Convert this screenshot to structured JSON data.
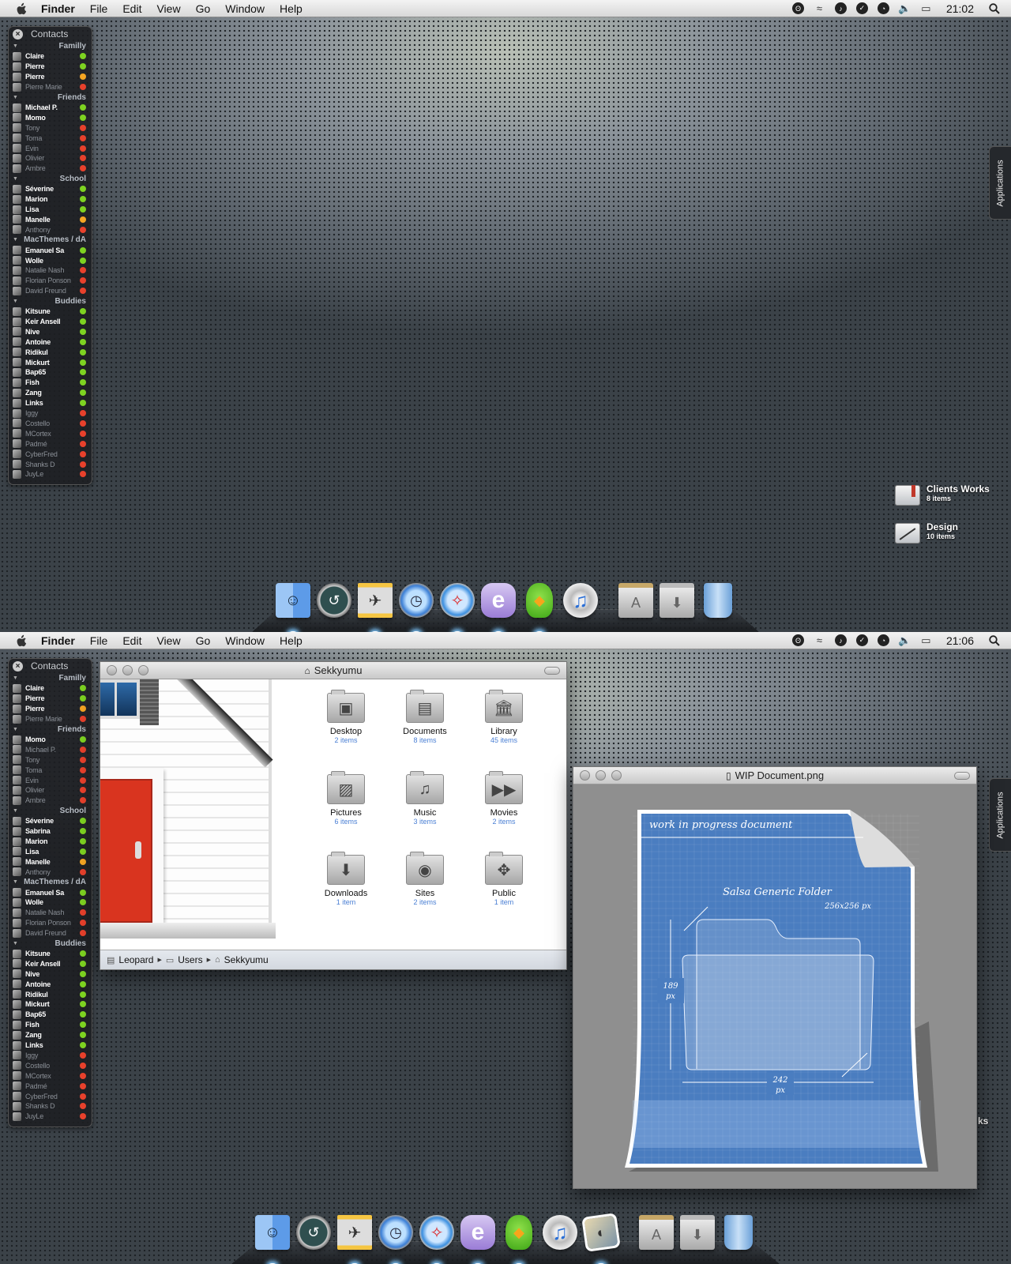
{
  "menubar": {
    "app": "Finder",
    "menus": [
      "File",
      "Edit",
      "View",
      "Go",
      "Window",
      "Help"
    ],
    "status_icons": [
      "growl-icon",
      "sync-icon",
      "itunes-icon",
      "checkmark-icon",
      "timer-icon",
      "volume-icon",
      "battery-icon"
    ]
  },
  "colors": {
    "online": "#7ed321",
    "away": "#f5a623",
    "offline": "#e8412c",
    "item_count": "#4a7fd4",
    "door": "#d9341f"
  },
  "screens": [
    {
      "clock": "21:02",
      "stack_tab": "Applications",
      "contacts": {
        "title": "Contacts",
        "groups": [
          {
            "name": "Familly",
            "members": [
              {
                "name": "Claire",
                "status": "online"
              },
              {
                "name": "Pierre",
                "status": "online"
              },
              {
                "name": "Pierre",
                "status": "away"
              },
              {
                "name": "Pierre Marie",
                "status": "offline"
              }
            ]
          },
          {
            "name": "Friends",
            "members": [
              {
                "name": "Michael P.",
                "status": "online"
              },
              {
                "name": "Momo",
                "status": "online"
              },
              {
                "name": "Tony",
                "status": "offline"
              },
              {
                "name": "Toma",
                "status": "offline"
              },
              {
                "name": "Evin",
                "status": "offline"
              },
              {
                "name": "Olivier",
                "status": "offline"
              },
              {
                "name": "Ambre",
                "status": "offline"
              }
            ]
          },
          {
            "name": "School",
            "members": [
              {
                "name": "Séverine",
                "status": "online"
              },
              {
                "name": "Marion",
                "status": "online"
              },
              {
                "name": "Lisa",
                "status": "online"
              },
              {
                "name": "Manelle",
                "status": "away"
              },
              {
                "name": "Anthony",
                "status": "offline"
              }
            ]
          },
          {
            "name": "MacThemes / dA",
            "members": [
              {
                "name": "Emanuel Sa",
                "status": "online"
              },
              {
                "name": "Wolle",
                "status": "online"
              },
              {
                "name": "Natalie Nash",
                "status": "offline"
              },
              {
                "name": "Florian Ponson",
                "status": "offline"
              },
              {
                "name": "David Freund",
                "status": "offline"
              }
            ]
          },
          {
            "name": "Buddies",
            "members": [
              {
                "name": "Kitsune",
                "status": "online"
              },
              {
                "name": "Keir Ansell",
                "status": "online"
              },
              {
                "name": "Nive",
                "status": "online"
              },
              {
                "name": "Antoine",
                "status": "online"
              },
              {
                "name": "Ridikul",
                "status": "online"
              },
              {
                "name": "Mickurt",
                "status": "online"
              },
              {
                "name": "Bap65",
                "status": "online"
              },
              {
                "name": "Fish",
                "status": "online"
              },
              {
                "name": "Zang",
                "status": "online"
              },
              {
                "name": "Links",
                "status": "online"
              },
              {
                "name": "Iggy",
                "status": "offline"
              },
              {
                "name": "Costello",
                "status": "offline"
              },
              {
                "name": "MCortex",
                "status": "offline"
              },
              {
                "name": "Padmé",
                "status": "offline"
              },
              {
                "name": "CyberFred",
                "status": "offline"
              },
              {
                "name": "Shanks D",
                "status": "offline"
              },
              {
                "name": "JuyLe",
                "status": "offline"
              }
            ]
          }
        ]
      },
      "desktop_items": [
        {
          "name": "Clients Works",
          "count": "8 items",
          "icon": "bookmark"
        },
        {
          "name": "Design",
          "count": "10 items",
          "icon": "wand"
        }
      ],
      "dock": [
        {
          "name": "Finder",
          "icon": "finder",
          "glyph": "☺",
          "running": true
        },
        {
          "name": "Time Machine",
          "icon": "timemachine",
          "glyph": "↺",
          "running": false
        },
        {
          "name": "F1 Racer",
          "icon": "car",
          "glyph": "✈",
          "running": true
        },
        {
          "name": "Alarm Clock",
          "icon": "clock",
          "glyph": "◷",
          "running": true
        },
        {
          "name": "Safari",
          "icon": "safari",
          "glyph": "✧",
          "running": true
        },
        {
          "name": "Entourage",
          "icon": "entourage",
          "glyph": "e",
          "running": true
        },
        {
          "name": "Adium",
          "icon": "adium",
          "glyph": "◆",
          "running": true
        },
        {
          "name": "iTunes",
          "icon": "itunes",
          "glyph": "♫",
          "running": false
        },
        {
          "sep": true
        },
        {
          "name": "Applications",
          "icon": "stack-apps",
          "glyph": "A",
          "running": false
        },
        {
          "name": "Downloads",
          "icon": "stack-downloads",
          "glyph": "⬇",
          "running": false
        },
        {
          "name": "Trash",
          "icon": "trash",
          "glyph": "",
          "running": false
        }
      ]
    },
    {
      "clock": "21:06",
      "stack_tab": "Applications",
      "contacts": {
        "title": "Contacts",
        "groups": [
          {
            "name": "Familly",
            "members": [
              {
                "name": "Claire",
                "status": "online"
              },
              {
                "name": "Pierre",
                "status": "online"
              },
              {
                "name": "Pierre",
                "status": "away"
              },
              {
                "name": "Pierre Marie",
                "status": "offline"
              }
            ]
          },
          {
            "name": "Friends",
            "members": [
              {
                "name": "Momo",
                "status": "online"
              },
              {
                "name": "Michael P.",
                "status": "offline"
              },
              {
                "name": "Tony",
                "status": "offline"
              },
              {
                "name": "Toma",
                "status": "offline"
              },
              {
                "name": "Evin",
                "status": "offline"
              },
              {
                "name": "Olivier",
                "status": "offline"
              },
              {
                "name": "Ambre",
                "status": "offline"
              }
            ]
          },
          {
            "name": "School",
            "members": [
              {
                "name": "Séverine",
                "status": "online"
              },
              {
                "name": "Sabrina",
                "status": "online"
              },
              {
                "name": "Marion",
                "status": "online"
              },
              {
                "name": "Lisa",
                "status": "online"
              },
              {
                "name": "Manelle",
                "status": "away"
              },
              {
                "name": "Anthony",
                "status": "offline"
              }
            ]
          },
          {
            "name": "MacThemes / dA",
            "members": [
              {
                "name": "Emanuel Sa",
                "status": "online"
              },
              {
                "name": "Wolle",
                "status": "online"
              },
              {
                "name": "Natalie Nash",
                "status": "offline"
              },
              {
                "name": "Florian Ponson",
                "status": "offline"
              },
              {
                "name": "David Freund",
                "status": "offline"
              }
            ]
          },
          {
            "name": "Buddies",
            "members": [
              {
                "name": "Kitsune",
                "status": "online"
              },
              {
                "name": "Keir Ansell",
                "status": "online"
              },
              {
                "name": "Nive",
                "status": "online"
              },
              {
                "name": "Antoine",
                "status": "online"
              },
              {
                "name": "Ridikul",
                "status": "online"
              },
              {
                "name": "Mickurt",
                "status": "online"
              },
              {
                "name": "Bap65",
                "status": "online"
              },
              {
                "name": "Fish",
                "status": "online"
              },
              {
                "name": "Zang",
                "status": "online"
              },
              {
                "name": "Links",
                "status": "online"
              },
              {
                "name": "Iggy",
                "status": "offline"
              },
              {
                "name": "Costello",
                "status": "offline"
              },
              {
                "name": "MCortex",
                "status": "offline"
              },
              {
                "name": "Padmé",
                "status": "offline"
              },
              {
                "name": "CyberFred",
                "status": "offline"
              },
              {
                "name": "Shanks D",
                "status": "offline"
              },
              {
                "name": "JuyLe",
                "status": "offline"
              }
            ]
          }
        ]
      },
      "partial_desktop_label": "ks",
      "finder": {
        "title": "Sekkyumu",
        "items": [
          {
            "name": "Desktop",
            "count": "2 items",
            "glyph": "▣"
          },
          {
            "name": "Documents",
            "count": "8 items",
            "glyph": "▤"
          },
          {
            "name": "Library",
            "count": "45 items",
            "glyph": "🏛"
          },
          {
            "name": "Pictures",
            "count": "6 items",
            "glyph": "▨"
          },
          {
            "name": "Music",
            "count": "3 items",
            "glyph": "♫"
          },
          {
            "name": "Movies",
            "count": "2 items",
            "glyph": "▶▶"
          },
          {
            "name": "Downloads",
            "count": "1 item",
            "glyph": "⬇"
          },
          {
            "name": "Sites",
            "count": "2 items",
            "glyph": "◉"
          },
          {
            "name": "Public",
            "count": "1 item",
            "glyph": "✥"
          }
        ],
        "path": [
          "Leopard",
          "Users",
          "Sekkyumu"
        ]
      },
      "preview": {
        "title": "WIP Document.png",
        "doc_header": "work in progress document",
        "doc_title": "Salsa Generic Folder",
        "doc_size": "256x256 px",
        "height_value": "189",
        "height_unit": "px",
        "width_value": "242",
        "width_unit": "px"
      },
      "dock": [
        {
          "name": "Finder",
          "icon": "finder",
          "glyph": "☺",
          "running": true
        },
        {
          "name": "Time Machine",
          "icon": "timemachine",
          "glyph": "↺",
          "running": false
        },
        {
          "name": "F1 Racer",
          "icon": "car",
          "glyph": "✈",
          "running": true
        },
        {
          "name": "Alarm Clock",
          "icon": "clock",
          "glyph": "◷",
          "running": true
        },
        {
          "name": "Safari",
          "icon": "safari",
          "glyph": "✧",
          "running": true
        },
        {
          "name": "Entourage",
          "icon": "entourage",
          "glyph": "e",
          "running": true
        },
        {
          "name": "Adium",
          "icon": "adium",
          "glyph": "◆",
          "running": true
        },
        {
          "name": "iTunes",
          "icon": "itunes",
          "glyph": "♫",
          "running": false
        },
        {
          "name": "iPhoto",
          "icon": "iphoto",
          "glyph": "◐",
          "running": true
        },
        {
          "sep": true
        },
        {
          "name": "Applications",
          "icon": "stack-apps",
          "glyph": "A",
          "running": false
        },
        {
          "name": "Downloads",
          "icon": "stack-downloads",
          "glyph": "⬇",
          "running": false
        },
        {
          "name": "Trash",
          "icon": "trash",
          "glyph": "",
          "running": false
        }
      ]
    }
  ]
}
